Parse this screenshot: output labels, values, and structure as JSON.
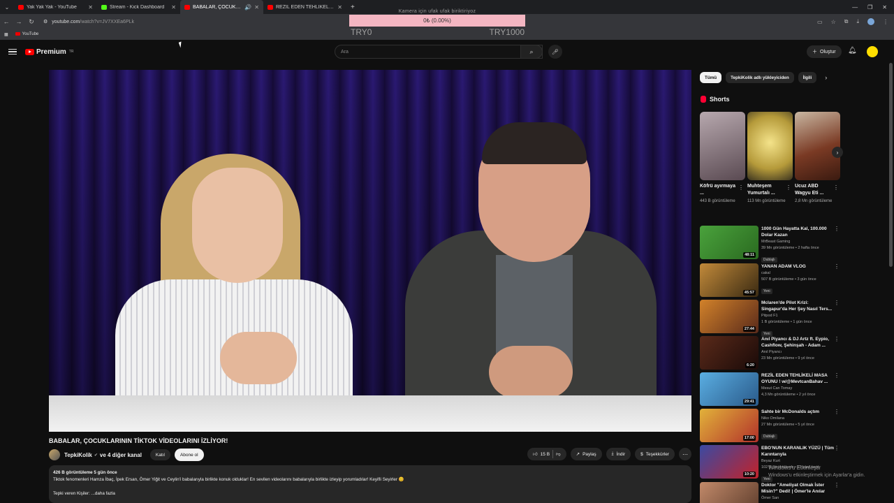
{
  "browser": {
    "tabs": [
      {
        "title": "Yak Yak Yak - YouTube",
        "favicon_color": "#ff0000"
      },
      {
        "title": "Stream - Kick Dashboard",
        "favicon_color": "#53fc18"
      },
      {
        "title": "BABALAR, ÇOCUKLARININ",
        "favicon_color": "#ff0000"
      },
      {
        "title": "REZİL EDEN TEHLİKELİ MASA O",
        "favicon_color": "#ff0000"
      }
    ],
    "url_host": "youtube.com",
    "url_path": "/watch?v=JV7XXEa6PLk",
    "bookmark": "YouTube"
  },
  "overlay": {
    "caption": "Kamera için ufak ufak biriktiriyoz",
    "progress_text": "0₺ (0.00%)",
    "progress_fraction": 0.0,
    "left_label": "TRY0",
    "right_label": "TRY1000"
  },
  "header": {
    "logo_text": "Premium",
    "logo_region": "TR",
    "search_placeholder": "Ara",
    "create_label": "Oluştur"
  },
  "video": {
    "title": "BABALAR, ÇOCUKLARININ TİKTOK VİDEOLARINI İZLİYOR!",
    "channel": "TepkiKolik",
    "channel_others": "ve 4 diğer kanal",
    "join_label": "Katıl",
    "subscribe_label": "Abone ol",
    "likes": "15 B",
    "share_label": "Paylaş",
    "download_label": "İndir",
    "thanks_label": "Teşekkürler",
    "views_meta": "426 B görüntüleme  5 gün önce",
    "description": "Tiktok fenomenleri Hamza İbaç, İpek Ersan, Ömer Yiğit ve Ceylin'i babalarıyla birlikte konuk olduklar! En sevilen videolarını babalarıyla birlikte izleyip yorumladılar! Keyifli Seyirler 😊",
    "description_more": "Tepki veren Kişiler: ...daha fazla"
  },
  "sidebar": {
    "chips": [
      "Tümü",
      "TepkiKolik adlı yükleyiciden",
      "İlgili",
      "İ"
    ],
    "shorts_label": "Shorts",
    "shorts": [
      {
        "title": "Köfrü ayırmaya ...",
        "views": "443 B görüntüleme",
        "color": "#8a7a82"
      },
      {
        "title": "Muhteşem Yumurtalı ...",
        "views": "113 Mn görüntüleme",
        "color": "#d9c870"
      },
      {
        "title": "Ucuz ABD Wagyu Eti ...",
        "views": "2,8 Mn görüntüleme",
        "color": "#6a3a2a"
      }
    ],
    "recommendations": [
      {
        "title": "1000 Gün Hayatta Kal, 100.000 Dolar Kazan",
        "channel": "MrBeast Gaming",
        "meta": "39 Mn görüntüleme • 2 hafta önce",
        "badge": "Dublajlı",
        "duration": "48:11",
        "color": "#4aa23c"
      },
      {
        "title": "YANAN ADAM VLOG",
        "channel": "cakal",
        "meta": "507 B görüntüleme • 3 gün önce",
        "badge": "Yeni",
        "duration": "45:57",
        "color": "#7a5a2a"
      },
      {
        "title": "Mclaren'de Pilot Krizi: Singapur'da Her Şey Nasıl Ters...",
        "channel": "Pitpod F1",
        "meta": "1 B görüntüleme • 1 gün önce",
        "badge": "Yeni",
        "duration": "27:44",
        "color": "#a0582a"
      },
      {
        "title": "Anıl Piyancı & DJ Artz ft. Eypio, Cashflow, Şehinşah - Adam ...",
        "channel": "Anıl Piyancı",
        "meta": "23 Mn görüntüleme • 9 yıl önce",
        "badge": "",
        "duration": "6:20",
        "color": "#3a1a14"
      },
      {
        "title": "REZİL EDEN TEHLİKELİ MASA OYUNU ! w/@MevtcanBahav ...",
        "channel": "Mesut Can Tomay",
        "meta": "4,3 Mn görüntüleme • 2 yıl önce",
        "badge": "",
        "duration": "29:41",
        "color": "#3a9ad2"
      },
      {
        "title": "Sahte bir McDonalds açtım",
        "channel": "Niko Omilana",
        "meta": "27 Mn görüntüleme • 5 yıl önce",
        "badge": "Dublajlı",
        "duration": "17:00",
        "color": "#c23a2a"
      },
      {
        "title": "EBO'NUN KARANLIK YÜZÜ | Tüm Karıntarıyla",
        "channel": "Beyaz Kurt",
        "meta": "102 B görüntüleme • 13 saat önce",
        "badge": "Yeni",
        "duration": "10:20",
        "color": "#2a3a8a"
      },
      {
        "title": "Doktor \"Ameliyat Olmak İster Misin?\" Dedi! | Ömer'le Anılar",
        "channel": "Ömer Sarı",
        "meta": "",
        "badge": "",
        "duration": "",
        "color": "#8a4a3a"
      }
    ]
  },
  "windows_notice": {
    "line1": "Windows'u Etkinleştir",
    "line2": "Windows'u etkinleştirmek için Ayarlar'a gidin."
  }
}
